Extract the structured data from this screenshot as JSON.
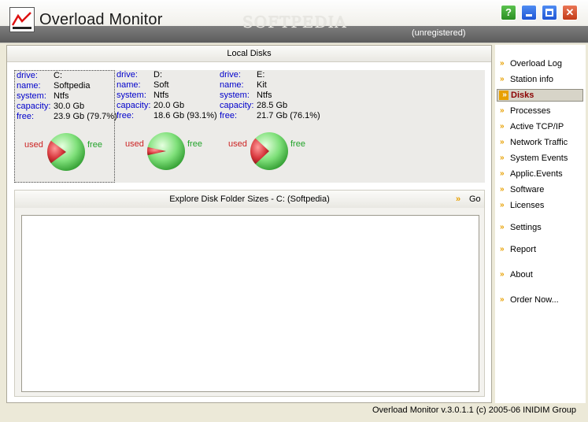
{
  "window": {
    "title": "Overload Monitor",
    "status": "(unregistered)",
    "watermark": "SOFTPEDIA",
    "buttons": {
      "help": "?",
      "minimize": "",
      "maximize": "",
      "close": "✕"
    }
  },
  "local_disks": {
    "header": "Local Disks",
    "field_labels": {
      "drive": "drive:",
      "name": "name:",
      "system": "system:",
      "capacity": "capacity:",
      "free": "free:"
    },
    "used_label": "used",
    "free_label": "free",
    "disks": [
      {
        "drive": "C:",
        "name": "Softpedia",
        "system": "Ntfs",
        "capacity": "30.0 Gb",
        "free": "23.9 Gb (79.7%)",
        "free_fraction": 0.797,
        "selected": true
      },
      {
        "drive": "D:",
        "name": "Soft",
        "system": "Ntfs",
        "capacity": "20.0 Gb",
        "free": "18.6 Gb (93.1%)",
        "free_fraction": 0.931,
        "selected": false
      },
      {
        "drive": "E:",
        "name": "Kit",
        "system": "Ntfs",
        "capacity": "28.5 Gb",
        "free": "21.7 Gb (76.1%)",
        "free_fraction": 0.761,
        "selected": false
      }
    ]
  },
  "explore": {
    "title": "Explore Disk Folder Sizes - C: (Softpedia)",
    "go_label": "Go"
  },
  "nav": {
    "items": [
      {
        "label": "Overload Log"
      },
      {
        "label": "Station info"
      },
      {
        "label": "Disks",
        "active": true
      },
      {
        "label": "Processes"
      },
      {
        "label": "Active TCP/IP"
      },
      {
        "label": "Network Traffic"
      },
      {
        "label": "System Events"
      },
      {
        "label": "Applic.Events"
      },
      {
        "label": "Software"
      },
      {
        "label": "Licenses"
      },
      {
        "label": "Settings"
      },
      {
        "label": "Report"
      },
      {
        "label": "About"
      },
      {
        "label": "Order Now..."
      }
    ]
  },
  "status_bar": {
    "text": "Overload Monitor v.3.0.1.1 (c) 2005-06 INIDIM Group"
  },
  "colors": {
    "used": "#d8383e",
    "free": "#7fe07a",
    "label_key": "#0000cc",
    "active_nav": "#8b0000",
    "arrow": "#e8a000"
  }
}
